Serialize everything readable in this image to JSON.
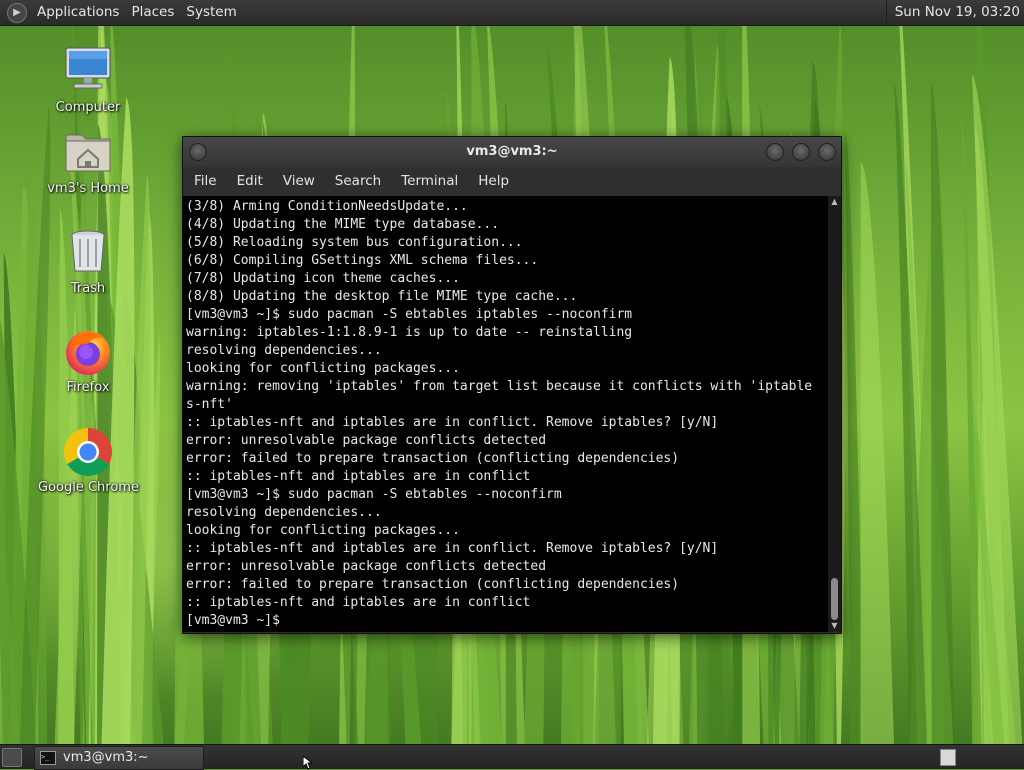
{
  "top_panel": {
    "menus": [
      "Applications",
      "Places",
      "System"
    ],
    "clock": "Sun Nov 19, 03:20",
    "distro_icon": "distro-logo-icon"
  },
  "desktop": {
    "icons": [
      {
        "label": "Computer",
        "icon": "computer-icon"
      },
      {
        "label": "vm3's Home",
        "icon": "home-folder-icon"
      },
      {
        "label": "Trash",
        "icon": "trash-icon"
      },
      {
        "label": "Firefox",
        "icon": "firefox-icon"
      },
      {
        "label": "Google Chrome",
        "icon": "chrome-icon"
      }
    ]
  },
  "terminal": {
    "title": "vm3@vm3:~",
    "menu": [
      "File",
      "Edit",
      "View",
      "Search",
      "Terminal",
      "Help"
    ],
    "lines": [
      "(3/8) Arming ConditionNeedsUpdate...",
      "(4/8) Updating the MIME type database...",
      "(5/8) Reloading system bus configuration...",
      "(6/8) Compiling GSettings XML schema files...",
      "(7/8) Updating icon theme caches...",
      "(8/8) Updating the desktop file MIME type cache...",
      "[vm3@vm3 ~]$ sudo pacman -S ebtables iptables --noconfirm",
      "warning: iptables-1:1.8.9-1 is up to date -- reinstalling",
      "resolving dependencies...",
      "looking for conflicting packages...",
      "warning: removing 'iptables' from target list because it conflicts with 'iptable",
      "s-nft'",
      ":: iptables-nft and iptables are in conflict. Remove iptables? [y/N]",
      "error: unresolvable package conflicts detected",
      "error: failed to prepare transaction (conflicting dependencies)",
      ":: iptables-nft and iptables are in conflict",
      "[vm3@vm3 ~]$ sudo pacman -S ebtables --noconfirm",
      "resolving dependencies...",
      "looking for conflicting packages...",
      ":: iptables-nft and iptables are in conflict. Remove iptables? [y/N]",
      "error: unresolvable package conflicts detected",
      "error: failed to prepare transaction (conflicting dependencies)",
      ":: iptables-nft and iptables are in conflict",
      "[vm3@vm3 ~]$"
    ],
    "scroll_position_fraction": 1.0,
    "colors": {
      "background": "#000000",
      "foreground": "#e8e8e8"
    }
  },
  "bottom_panel": {
    "tasks": [
      {
        "label": "vm3@vm3:~",
        "icon": "terminal-icon"
      }
    ]
  }
}
